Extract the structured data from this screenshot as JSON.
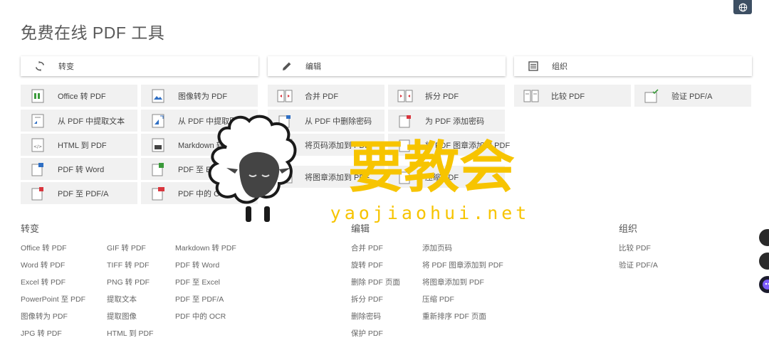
{
  "page": {
    "title": "免费在线 PDF 工具"
  },
  "categories": [
    {
      "label": "转变",
      "icon": "refresh-icon"
    },
    {
      "label": "编辑",
      "icon": "pencil-icon"
    },
    {
      "label": "组织",
      "icon": "list-icon"
    }
  ],
  "tools": {
    "convert": [
      "Office 转 PDF",
      "图像转为 PDF",
      "从 PDF 中提取文本",
      "从 PDF 中提取图像",
      "HTML 到 PDF",
      "Markdown 转 PDF",
      "PDF 转 Word",
      "PDF 至 Excel",
      "PDF 至 PDF/A",
      "PDF 中的 OCR"
    ],
    "edit": [
      "合并 PDF",
      "拆分 PDF",
      "从 PDF 中删除密码",
      "为 PDF 添加密码",
      "将页码添加到 PDF",
      "将 PDF 图章添加到 PDF",
      "将图章添加到 PDF",
      "压缩 PDF"
    ],
    "organize": [
      "比较 PDF",
      "验证 PDF/A"
    ]
  },
  "footer": {
    "convert": {
      "title": "转变",
      "col1": [
        "Office 转 PDF",
        "Word 转 PDF",
        "Excel 转 PDF",
        "PowerPoint 至 PDF",
        "图像转为 PDF",
        "JPG 转 PDF"
      ],
      "col2": [
        "GIF 转 PDF",
        "TIFF 转 PDF",
        "PNG 转 PDF",
        "提取文本",
        "提取图像",
        "HTML 到 PDF"
      ],
      "col3": [
        "Markdown 转 PDF",
        "PDF 转 Word",
        "PDF 至 Excel",
        "PDF 至 PDF/A",
        "PDF 中的 OCR"
      ]
    },
    "edit": {
      "title": "编辑",
      "col1": [
        "合并 PDF",
        "旋转 PDF",
        "删除 PDF 页面",
        "拆分 PDF",
        "删除密码",
        "保护 PDF"
      ],
      "col2": [
        "添加页码",
        "将 PDF 图章添加到 PDF",
        "将图章添加到 PDF",
        "压缩 PDF",
        "重新排序 PDF 页面"
      ]
    },
    "organize": {
      "title": "组织",
      "col1": [
        "比较 PDF",
        "验证 PDF/A"
      ]
    }
  },
  "watermark": {
    "text": "要教会",
    "url": "yaojiaohui.net"
  },
  "colors": {
    "header_bg": "#ffffff",
    "tool_bg": "#f1f1f1",
    "accent_green": "#3a9a3a",
    "accent_blue": "#2f6fc4",
    "accent_red": "#d9363e",
    "watermark_yellow": "#f7c400"
  }
}
